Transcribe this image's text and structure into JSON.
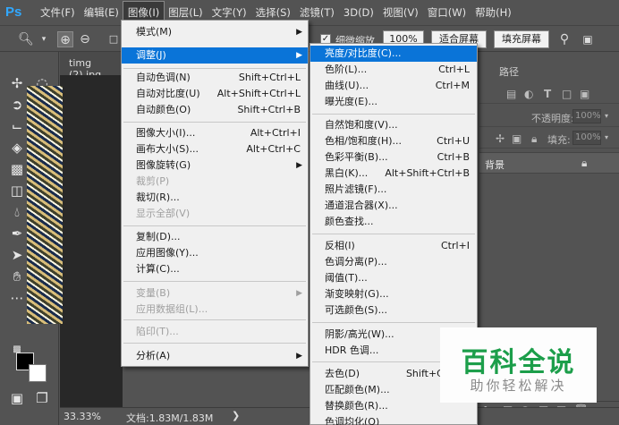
{
  "app": {
    "logo": "Ps"
  },
  "menubar": {
    "items": [
      "文件(F)",
      "编辑(E)",
      "图像(I)",
      "图层(L)",
      "文字(Y)",
      "选择(S)",
      "滤镜(T)",
      "3D(D)",
      "视图(V)",
      "窗口(W)",
      "帮助(H)"
    ]
  },
  "optionsbar": {
    "scrubby_zoom_label": "细微缩放",
    "zoom_btn": "100%",
    "fit_screen_btn": "适合屏幕",
    "fill_screen_btn": "填充屏幕"
  },
  "document": {
    "tab_title": "timg (2).jpg",
    "zoom": "33.33%",
    "doc_info": "文档:1.83M/1.83M"
  },
  "image_menu": {
    "items": [
      {
        "label": "模式(M)",
        "submenu": true
      },
      {
        "label": "调整(J)",
        "submenu": true,
        "highlight": true
      },
      {
        "label": "自动色调(N)",
        "shortcut": "Shift+Ctrl+L"
      },
      {
        "label": "自动对比度(U)",
        "shortcut": "Alt+Shift+Ctrl+L"
      },
      {
        "label": "自动颜色(O)",
        "shortcut": "Shift+Ctrl+B"
      },
      {
        "label": "图像大小(I)...",
        "shortcut": "Alt+Ctrl+I"
      },
      {
        "label": "画布大小(S)...",
        "shortcut": "Alt+Ctrl+C"
      },
      {
        "label": "图像旋转(G)",
        "submenu": true
      },
      {
        "label": "裁剪(P)",
        "disabled": true
      },
      {
        "label": "裁切(R)..."
      },
      {
        "label": "显示全部(V)",
        "disabled": true
      },
      {
        "label": "复制(D)..."
      },
      {
        "label": "应用图像(Y)..."
      },
      {
        "label": "计算(C)..."
      },
      {
        "label": "变量(B)",
        "submenu": true,
        "disabled": true
      },
      {
        "label": "应用数据组(L)...",
        "disabled": true
      },
      {
        "label": "陷印(T)...",
        "disabled": true
      },
      {
        "label": "分析(A)",
        "submenu": true
      }
    ]
  },
  "adjust_menu": {
    "items": [
      {
        "label": "亮度/对比度(C)...",
        "highlight": true
      },
      {
        "label": "色阶(L)...",
        "shortcut": "Ctrl+L"
      },
      {
        "label": "曲线(U)...",
        "shortcut": "Ctrl+M"
      },
      {
        "label": "曝光度(E)..."
      },
      {
        "label": "自然饱和度(V)..."
      },
      {
        "label": "色相/饱和度(H)...",
        "shortcut": "Ctrl+U"
      },
      {
        "label": "色彩平衡(B)...",
        "shortcut": "Ctrl+B"
      },
      {
        "label": "黑白(K)...",
        "shortcut": "Alt+Shift+Ctrl+B"
      },
      {
        "label": "照片滤镜(F)..."
      },
      {
        "label": "通道混合器(X)..."
      },
      {
        "label": "颜色查找..."
      },
      {
        "label": "反相(I)",
        "shortcut": "Ctrl+I"
      },
      {
        "label": "色调分离(P)..."
      },
      {
        "label": "阈值(T)..."
      },
      {
        "label": "渐变映射(G)..."
      },
      {
        "label": "可选颜色(S)..."
      },
      {
        "label": "阴影/高光(W)..."
      },
      {
        "label": "HDR 色调..."
      },
      {
        "label": "去色(D)",
        "shortcut": "Shift+Ctrl+U"
      },
      {
        "label": "匹配颜色(M)..."
      },
      {
        "label": "替换颜色(R)..."
      },
      {
        "label": "色调均化(Q)"
      }
    ]
  },
  "right_panel": {
    "paths_tab": "路径",
    "opacity_label": "不透明度:",
    "opacity_value": "100%",
    "fill_label": "填充:",
    "fill_value": "100%",
    "layer_name": "背景"
  },
  "watermark": {
    "title": "百科全说",
    "subtitle": "助你轻松解决"
  },
  "colors": {
    "highlight": "#0a74d8",
    "ui_bg": "#535353",
    "brand_green": "#1c9e4a"
  }
}
